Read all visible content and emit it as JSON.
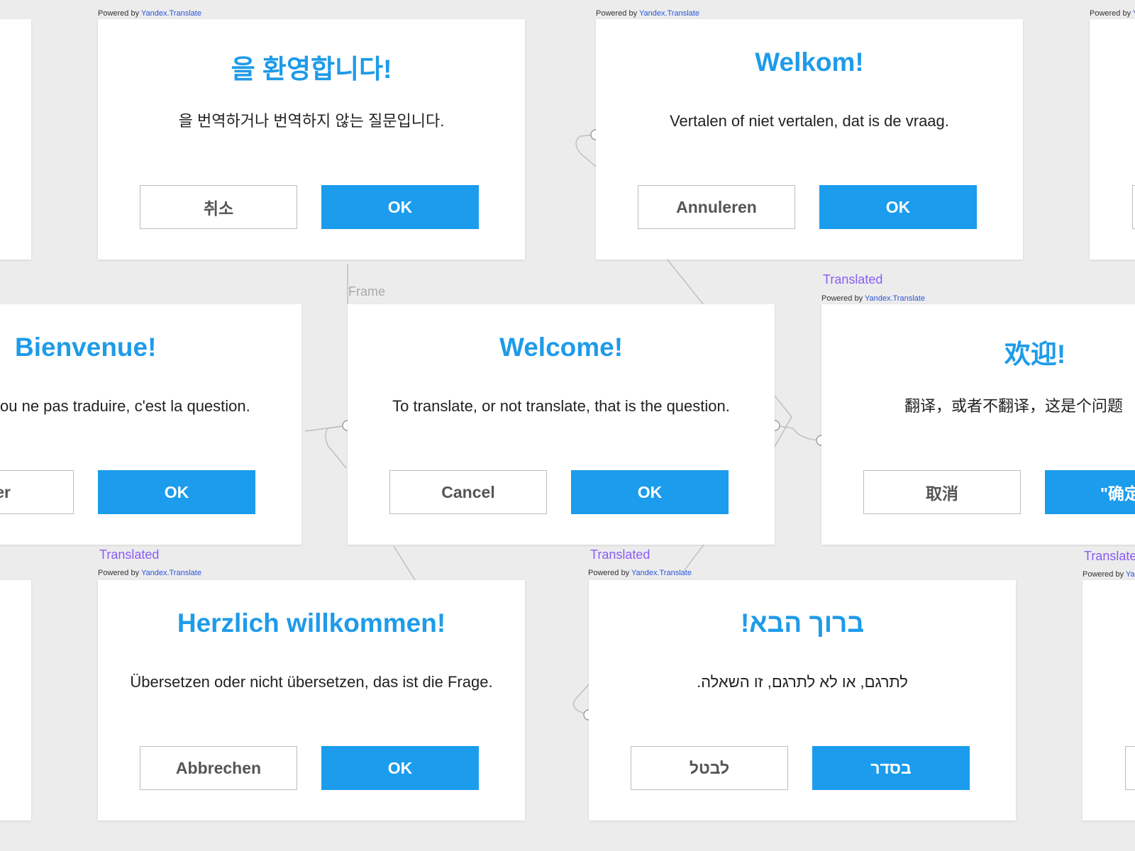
{
  "frame_label": "Frame",
  "meta": {
    "translated": "Translated",
    "powered_prefix": "Powered by ",
    "powered_service": "Yandex.Translate"
  },
  "dialogs": {
    "korean": {
      "title": "을 환영합니다!",
      "message": "을 번역하거나 번역하지 않는 질문입니다.",
      "cancel": "취소",
      "ok": "OK"
    },
    "dutch": {
      "title": "Welkom!",
      "message": "Vertalen of niet vertalen, dat is de vraag.",
      "cancel": "Annuleren",
      "ok": "OK"
    },
    "french": {
      "title": "Bienvenue!",
      "message": "ou ne pas traduire, c'est la question.",
      "cancel": "uler",
      "ok": "OK"
    },
    "english": {
      "title": "Welcome!",
      "message": "To translate, or not translate, that is the question.",
      "cancel": "Cancel",
      "ok": "OK"
    },
    "chinese": {
      "title": "欢迎!",
      "message": "翻译，或者不翻译，这是个问题",
      "cancel": "取消",
      "ok": "\"确定"
    },
    "german": {
      "title": "Herzlich willkommen!",
      "message": "Übersetzen oder nicht übersetzen, das ist die Frage.",
      "cancel": "Abbrechen",
      "ok": "OK"
    },
    "hebrew": {
      "title": "ברוך הבא!",
      "message": "לתרגם, או לא לתרגם, זו השאלה.",
      "cancel": "לבטל",
      "ok": "בסדר"
    }
  }
}
